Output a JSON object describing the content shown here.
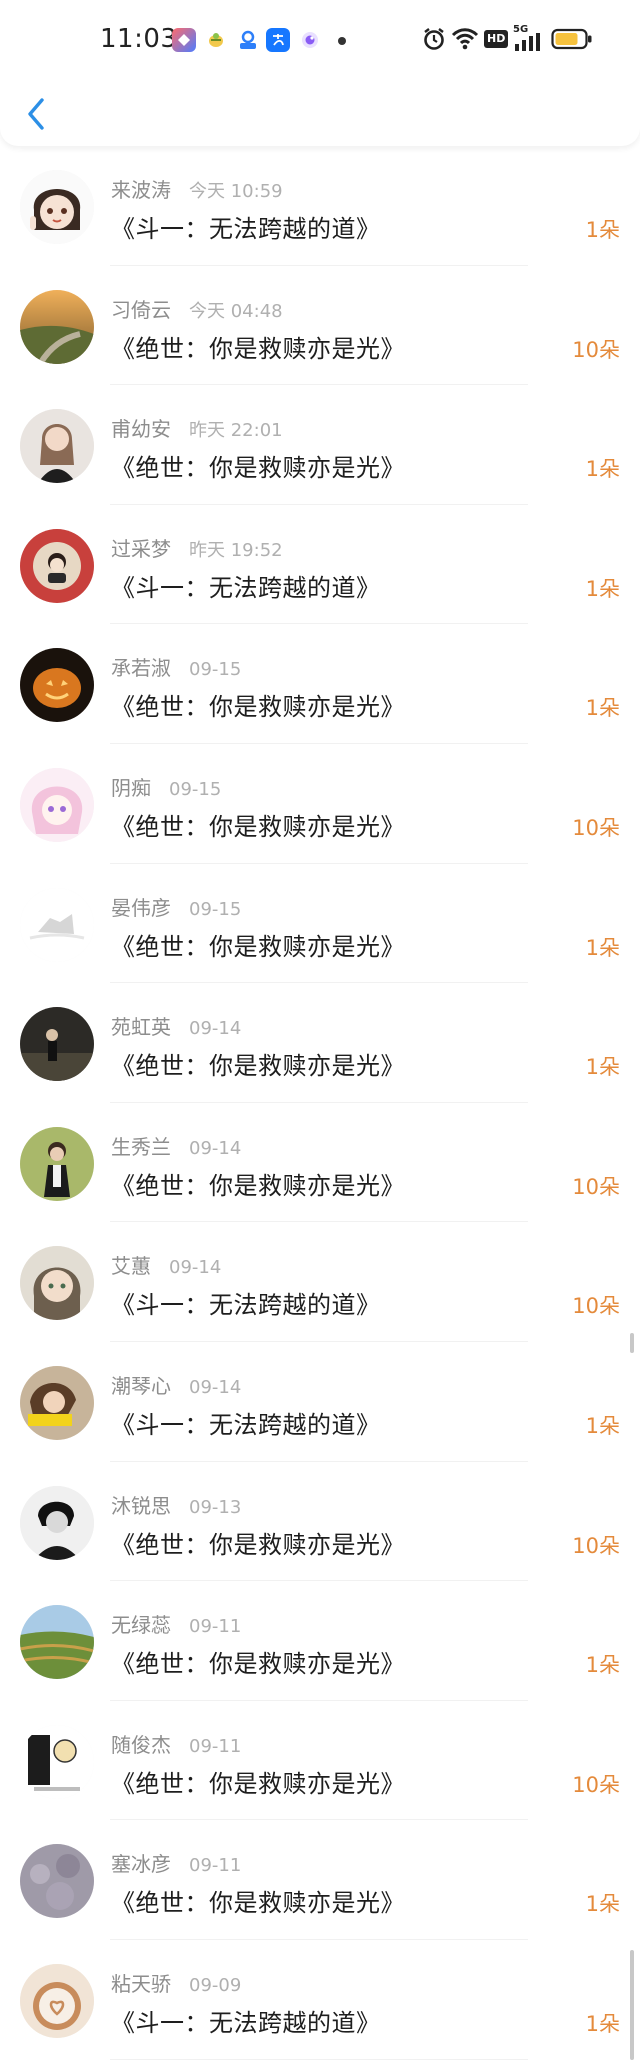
{
  "status_bar": {
    "time": "11:03",
    "hd_label": "HD",
    "network_label": "5G"
  },
  "header": {
    "back_icon": "chevron-left-icon"
  },
  "colors": {
    "count_orange": "#e48a3b",
    "back_blue": "#2c8fe6",
    "battery_yellow": "#f6c23e"
  },
  "items": [
    {
      "name": "来波涛",
      "time": "今天 10:59",
      "title": "《斗一：无法跨越的道》",
      "count": "1朵"
    },
    {
      "name": "习倚云",
      "time": "今天 04:48",
      "title": "《绝世：你是救赎亦是光》",
      "count": "10朵"
    },
    {
      "name": "甫幼安",
      "time": "昨天 22:01",
      "title": "《绝世：你是救赎亦是光》",
      "count": "1朵"
    },
    {
      "name": "过采梦",
      "time": "昨天 19:52",
      "title": "《斗一：无法跨越的道》",
      "count": "1朵"
    },
    {
      "name": "承若淑",
      "time": "09-15",
      "title": "《绝世：你是救赎亦是光》",
      "count": "1朵"
    },
    {
      "name": "阴痴",
      "time": "09-15",
      "title": "《绝世：你是救赎亦是光》",
      "count": "10朵"
    },
    {
      "name": "晏伟彦",
      "time": "09-15",
      "title": "《绝世：你是救赎亦是光》",
      "count": "1朵"
    },
    {
      "name": "苑虹英",
      "time": "09-14",
      "title": "《绝世：你是救赎亦是光》",
      "count": "1朵"
    },
    {
      "name": "生秀兰",
      "time": "09-14",
      "title": "《绝世：你是救赎亦是光》",
      "count": "10朵"
    },
    {
      "name": "艾蕙",
      "time": "09-14",
      "title": "《斗一：无法跨越的道》",
      "count": "10朵"
    },
    {
      "name": "潮琴心",
      "time": "09-14",
      "title": "《斗一：无法跨越的道》",
      "count": "1朵"
    },
    {
      "name": "沐锐思",
      "time": "09-13",
      "title": "《绝世：你是救赎亦是光》",
      "count": "10朵"
    },
    {
      "name": "无绿蕊",
      "time": "09-11",
      "title": "《绝世：你是救赎亦是光》",
      "count": "1朵"
    },
    {
      "name": "随俊杰",
      "time": "09-11",
      "title": "《绝世：你是救赎亦是光》",
      "count": "10朵"
    },
    {
      "name": "塞冰彦",
      "time": "09-11",
      "title": "《绝世：你是救赎亦是光》",
      "count": "1朵"
    },
    {
      "name": "粘天骄",
      "time": "09-09",
      "title": "《斗一：无法跨越的道》",
      "count": "1朵"
    }
  ]
}
